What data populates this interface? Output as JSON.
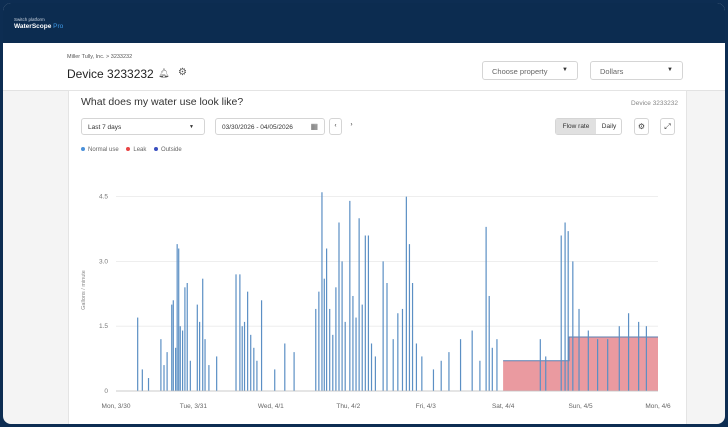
{
  "app": {
    "platform_label": "Switch platform",
    "brand_name": "WaterScope",
    "brand_suffix": "Pro"
  },
  "device_header": {
    "breadcrumb": "Miller Tully, Inc.  >  3233232",
    "title": "Device 3233232",
    "property_select": "Choose property",
    "currency_select": "Dollars"
  },
  "panel": {
    "title": "What does my water use look like?",
    "device_label": "Device 3233232",
    "range_select": "Last 7 days",
    "date_range": "03/30/2026 - 04/05/2026",
    "view_flow_rate": "Flow rate",
    "view_daily": "Daily",
    "legend": [
      {
        "label": "Normal use",
        "color": "#4a90d9"
      },
      {
        "label": "Leak",
        "color": "#e84545"
      },
      {
        "label": "Outside",
        "color": "#3b4fbf"
      }
    ]
  },
  "chart_data": {
    "type": "bar",
    "ylabel": "Gallons / minute",
    "ylim": [
      0,
      5
    ],
    "yticks": [
      "0",
      "1.5",
      "3.0",
      "4.5"
    ],
    "xticks": [
      "Mon, 3/30",
      "Tue, 3/31",
      "Wed, 4/1",
      "Thu, 4/2",
      "Fri, 4/3",
      "Sat, 4/4",
      "Sun, 4/5",
      "Mon, 4/6"
    ],
    "series": [
      {
        "name": "Normal use",
        "color": "#5b8fc4",
        "spikes": [
          [
            0.28,
            1.7
          ],
          [
            0.34,
            0.5
          ],
          [
            0.42,
            0.3
          ],
          [
            0.58,
            1.2
          ],
          [
            0.62,
            0.6
          ],
          [
            0.66,
            0.9
          ],
          [
            0.72,
            2.0
          ],
          [
            0.74,
            2.1
          ],
          [
            0.77,
            1.0
          ],
          [
            0.79,
            3.4
          ],
          [
            0.81,
            3.3
          ],
          [
            0.83,
            1.5
          ],
          [
            0.86,
            1.4
          ],
          [
            0.89,
            2.4
          ],
          [
            0.92,
            2.5
          ],
          [
            0.96,
            0.7
          ],
          [
            1.05,
            2.0
          ],
          [
            1.08,
            1.6
          ],
          [
            1.12,
            2.6
          ],
          [
            1.15,
            1.2
          ],
          [
            1.2,
            0.6
          ],
          [
            1.3,
            0.8
          ],
          [
            1.55,
            2.7
          ],
          [
            1.6,
            2.7
          ],
          [
            1.63,
            1.5
          ],
          [
            1.66,
            1.6
          ],
          [
            1.7,
            2.3
          ],
          [
            1.74,
            1.3
          ],
          [
            1.78,
            1.0
          ],
          [
            1.82,
            0.7
          ],
          [
            1.88,
            2.1
          ],
          [
            2.05,
            0.5
          ],
          [
            2.18,
            1.1
          ],
          [
            2.3,
            0.9
          ],
          [
            2.58,
            1.9
          ],
          [
            2.62,
            2.3
          ],
          [
            2.66,
            4.6
          ],
          [
            2.69,
            2.6
          ],
          [
            2.72,
            3.3
          ],
          [
            2.76,
            1.9
          ],
          [
            2.8,
            1.3
          ],
          [
            2.84,
            2.4
          ],
          [
            2.88,
            3.9
          ],
          [
            2.92,
            3.0
          ],
          [
            2.96,
            1.6
          ],
          [
            3.02,
            4.4
          ],
          [
            3.06,
            2.2
          ],
          [
            3.1,
            1.7
          ],
          [
            3.14,
            4.0
          ],
          [
            3.18,
            2.0
          ],
          [
            3.22,
            3.6
          ],
          [
            3.26,
            3.6
          ],
          [
            3.3,
            1.1
          ],
          [
            3.35,
            0.8
          ],
          [
            3.45,
            3.0
          ],
          [
            3.5,
            2.5
          ],
          [
            3.58,
            1.2
          ],
          [
            3.64,
            1.8
          ],
          [
            3.7,
            1.9
          ],
          [
            3.75,
            4.5
          ],
          [
            3.79,
            3.4
          ],
          [
            3.83,
            2.5
          ],
          [
            3.88,
            1.1
          ],
          [
            3.95,
            0.8
          ],
          [
            4.1,
            0.5
          ],
          [
            4.2,
            0.7
          ],
          [
            4.3,
            0.9
          ],
          [
            4.45,
            1.2
          ],
          [
            4.6,
            1.4
          ],
          [
            4.7,
            0.7
          ],
          [
            4.78,
            3.8
          ],
          [
            4.82,
            2.2
          ],
          [
            4.86,
            1.0
          ],
          [
            4.92,
            1.2
          ],
          [
            5.48,
            1.2
          ],
          [
            5.55,
            0.8
          ],
          [
            5.75,
            3.6
          ],
          [
            5.8,
            3.9
          ],
          [
            5.84,
            3.7
          ],
          [
            5.9,
            3.0
          ],
          [
            5.98,
            1.9
          ],
          [
            6.1,
            1.4
          ],
          [
            6.22,
            1.2
          ],
          [
            6.35,
            1.2
          ],
          [
            6.5,
            1.5
          ],
          [
            6.62,
            1.8
          ],
          [
            6.75,
            1.6
          ],
          [
            6.85,
            1.5
          ]
        ]
      },
      {
        "name": "Leak",
        "color": "#ea9aa0",
        "steps": [
          [
            5.0,
            0.0
          ],
          [
            5.0,
            0.7
          ],
          [
            5.85,
            0.7
          ],
          [
            5.85,
            1.25
          ],
          [
            7.0,
            1.25
          ],
          [
            7.0,
            0.0
          ]
        ]
      }
    ]
  }
}
